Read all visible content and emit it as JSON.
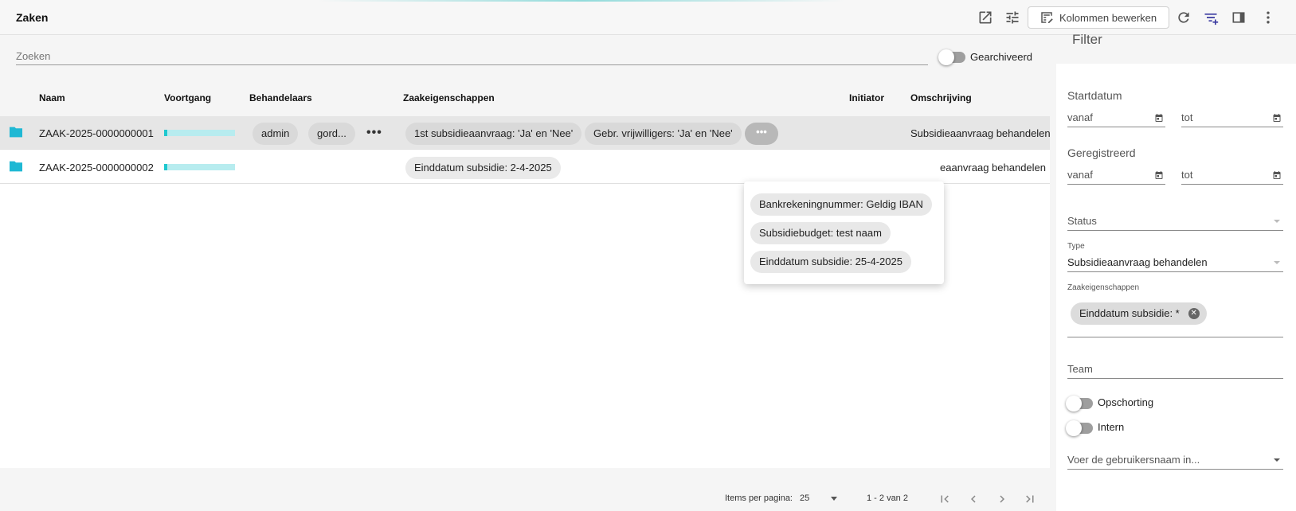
{
  "header": {
    "title": "Zaken",
    "edit_columns_label": "Kolommen bewerken"
  },
  "search": {
    "placeholder": "Zoeken",
    "archived_label": "Gearchiveerd"
  },
  "table": {
    "columns": [
      "Naam",
      "Voortgang",
      "Behandelaars",
      "Zaakeigenschappen",
      "Initiator",
      "Omschrijving"
    ],
    "rows": [
      {
        "name": "ZAAK-2025-0000000001",
        "progress": 0.05,
        "assignees": [
          "admin",
          "gord..."
        ],
        "assignees_more": "•••",
        "properties": [
          "1st subsidieaanvraag: 'Ja' en 'Nee'",
          "Gebr. vrijwilligers: 'Ja' en 'Nee'"
        ],
        "properties_more": "•••",
        "description": "Subsidieaanvraag behandelen"
      },
      {
        "name": "ZAAK-2025-0000000002",
        "progress": 0.05,
        "properties": [
          "Einddatum subsidie: 2-4-2025"
        ],
        "description": "eaanvraag behandelen"
      }
    ]
  },
  "popup": {
    "chips": [
      "Bankrekeningnummer: Geldig IBAN",
      "Subsidiebudget: test naam",
      "Einddatum subsidie: 25-4-2025"
    ]
  },
  "pagination": {
    "items_per_page_label": "Items per pagina:",
    "items_per_page_value": "25",
    "range_label": "1 - 2 van 2"
  },
  "filter": {
    "title": "Filter",
    "startdatum": {
      "label": "Startdatum",
      "from": "vanaf",
      "to": "tot"
    },
    "geregistreerd": {
      "label": "Geregistreerd",
      "from": "vanaf",
      "to": "tot"
    },
    "status_label": "Status",
    "type_label": "Type",
    "type_value": "Subsidieaanvraag behandelen",
    "zaakeigenschappen_label": "Zaakeigenschappen",
    "zaakeigenschappen_chip": "Einddatum subsidie: *",
    "team_label": "Team",
    "opschorting_label": "Opschorting",
    "intern_label": "Intern",
    "user_placeholder": "Voer de gebruikersnaam in..."
  },
  "colors": {
    "progress_fill": "#1fc8cf",
    "progress_track": "#b7ecef",
    "folder": "#1fb8d4",
    "selected_row": "#e6e6e6"
  },
  "icons": [
    "open-in-new-icon",
    "tune-icon",
    "edit-columns-icon",
    "refresh-icon",
    "filter-add-icon",
    "side-panel-icon",
    "more-vert-icon",
    "folder-icon",
    "calendar-icon",
    "first-page-icon",
    "prev-page-icon",
    "next-page-icon",
    "last-page-icon",
    "cancel-icon"
  ]
}
